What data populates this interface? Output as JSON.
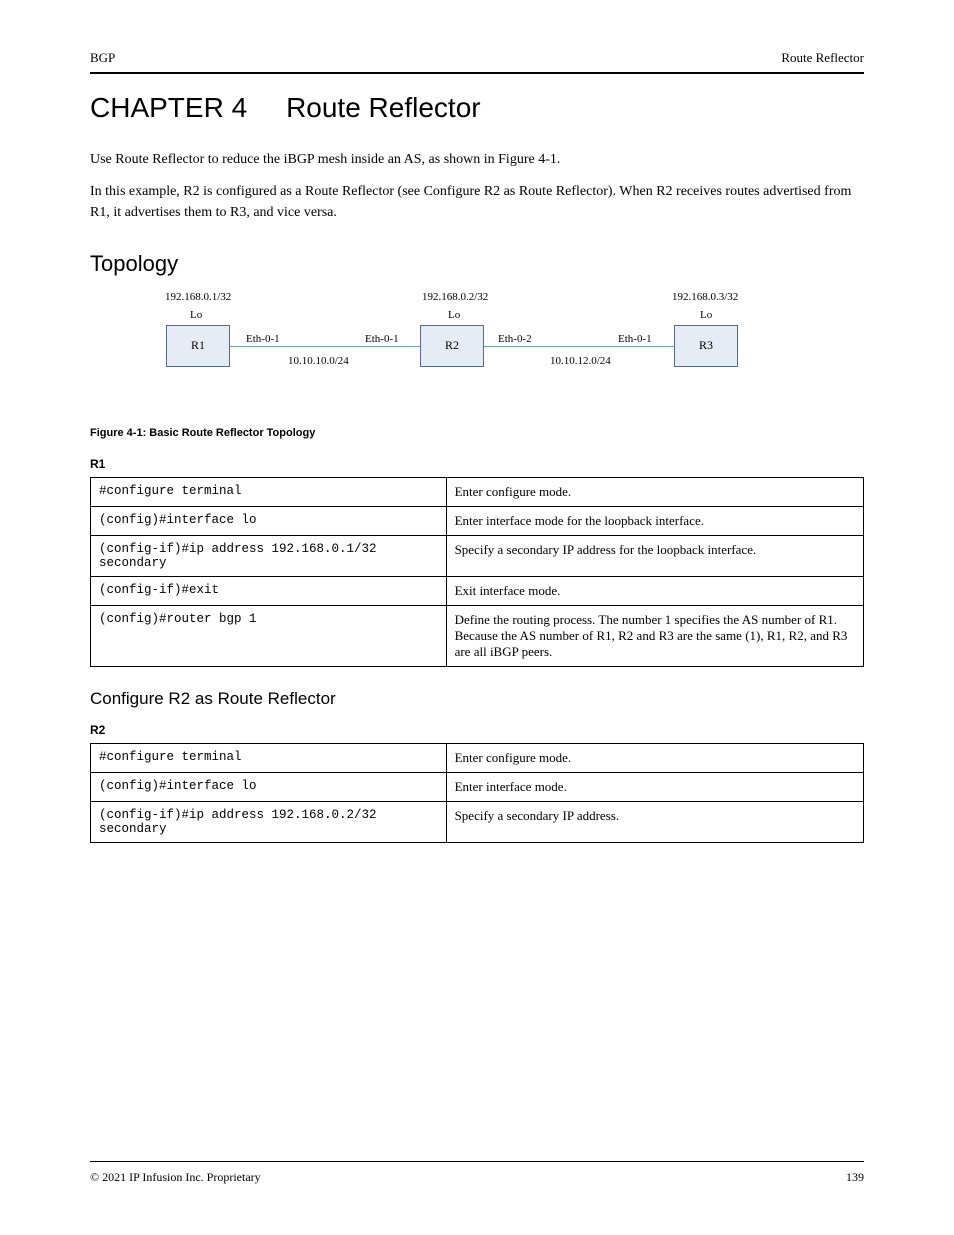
{
  "header": {
    "left": "BGP",
    "right": "Route Reflector"
  },
  "chapter": {
    "number": "CHAPTER 4",
    "title": "Route Reflector"
  },
  "intro": {
    "p1": "Use Route Reflector to reduce the iBGP mesh inside an AS, as shown in Figure 4-1.",
    "p2_a": "In this example, R2 is configured as a Route Reflector (see ",
    "p2_link": "Configure R2 as Route Reflector",
    "p2_b": "). When R2 receives routes advertised from R1, it advertises them to R3, and vice versa."
  },
  "section": "Topology",
  "diagram": {
    "r1": {
      "label": "R1",
      "lo": "Lo",
      "ip": "192.168.0.1/32",
      "if_r": "Eth-0-1"
    },
    "r2": {
      "label": "R2",
      "lo": "Lo",
      "ip": "192.168.0.2/32",
      "if_l": "Eth-0-1",
      "if_r": "Eth-0-2"
    },
    "r3": {
      "label": "R3",
      "lo": "Lo",
      "ip": "192.168.0.3/32",
      "if_l": "Eth-0-1"
    },
    "net12": "10.10.10.0/24",
    "net23": "10.10.12.0/24",
    "caption": "Figure 4-1: Basic Route Reflector Topology"
  },
  "r1": {
    "label": "R1",
    "rows": [
      {
        "l": "#configure terminal",
        "r": "Enter configure mode."
      },
      {
        "l": "(config)#interface lo",
        "r": "Enter interface mode for the loopback interface."
      },
      {
        "l": "(config-if)#ip address 192.168.0.1/32 secondary",
        "r": "Specify a secondary IP address for the loopback interface."
      },
      {
        "l": "(config-if)#exit",
        "r": "Exit interface mode."
      },
      {
        "l": "(config)#router bgp 1",
        "r": "Define the routing process. The number 1 specifies the AS number of R1. Because the AS number of R1, R2 and R3 are the same (1), R1, R2, and R3 are all iBGP peers."
      }
    ]
  },
  "r2": {
    "subheading": "Configure R2 as Route Reflector",
    "label": "R2",
    "rows": [
      {
        "l": "#configure terminal",
        "r": "Enter configure mode."
      },
      {
        "l": "(config)#interface lo",
        "r": "Enter interface mode."
      },
      {
        "l": "(config-if)#ip address 192.168.0.2/32 secondary",
        "r": "Specify a secondary IP address."
      }
    ]
  },
  "footer": {
    "left": "© 2021 IP Infusion Inc. Proprietary",
    "right": "139"
  }
}
